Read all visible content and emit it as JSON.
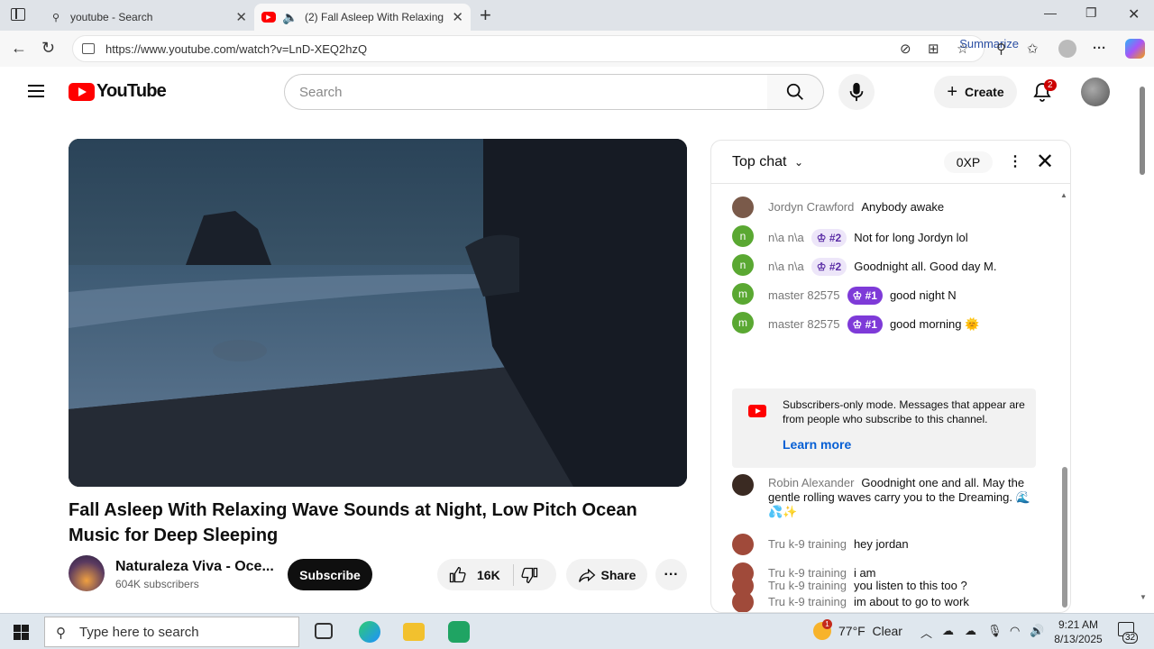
{
  "browser": {
    "tabs": [
      {
        "label": "youtube - Search"
      },
      {
        "label": "(2) Fall Asleep With Relaxing"
      }
    ],
    "url": "https://www.youtube.com/watch?v=LnD-XEQ2hzQ",
    "summarize_label": "Summarize"
  },
  "header": {
    "logo_text": "YouTube",
    "search_placeholder": "Search",
    "create_label": "Create",
    "notification_count": "2"
  },
  "video": {
    "title": "Fall Asleep With Relaxing Wave Sounds at Night, Low Pitch Ocean Music for Deep Sleeping",
    "channel_name": "Naturaleza Viva - Oce...",
    "subscribers": "604K subscribers",
    "subscribe_label": "Subscribe",
    "likes": "16K",
    "share_label": "Share"
  },
  "chat": {
    "mode_label": "Top chat",
    "xp": "0XP",
    "messages": [
      {
        "author": "Jordyn Crawford",
        "badge": "",
        "text": "Anybody awake",
        "avatar_letter": "",
        "avatar_color": "#7a5a4a"
      },
      {
        "author": "n\\a n\\a",
        "badge": "#2",
        "text": "Not for long Jordyn lol",
        "avatar_letter": "n",
        "avatar_color": "#5aa832"
      },
      {
        "author": "n\\a n\\a",
        "badge": "#2",
        "text": "Goodnight all. Good day M.",
        "avatar_letter": "n",
        "avatar_color": "#5aa832"
      },
      {
        "author": "master 82575",
        "badge": "#1",
        "text": "good night N",
        "avatar_letter": "m",
        "avatar_color": "#5aa832"
      },
      {
        "author": "master 82575",
        "badge": "#1",
        "text": "good morning 🌞",
        "avatar_letter": "m",
        "avatar_color": "#5aa832"
      },
      {
        "author": "Robin Alexander",
        "badge": "",
        "text": "Goodnight one and all. May the gentle rolling waves carry you to the Dreaming. 🌊💦✨",
        "avatar_letter": "",
        "avatar_color": "#3a2a22"
      },
      {
        "author": "Tru k-9 training",
        "badge": "",
        "text": "hey jordan",
        "avatar_letter": "",
        "avatar_color": "#a04a3a"
      },
      {
        "author": "Tru k-9 training",
        "badge": "",
        "text": "i am",
        "avatar_letter": "",
        "avatar_color": "#a04a3a"
      },
      {
        "author": "Tru k-9 training",
        "badge": "",
        "text": "im about to go to work",
        "avatar_letter": "",
        "avatar_color": "#a04a3a"
      },
      {
        "author": "Tru k-9 training",
        "badge": "",
        "text": "you listen to this too ?",
        "avatar_letter": "",
        "avatar_color": "#a04a3a"
      }
    ],
    "notice": {
      "text": "Subscribers-only mode. Messages that appear are from people who subscribe to this channel.",
      "link": "Learn more"
    }
  },
  "taskbar": {
    "search_placeholder": "Type here to search",
    "weather_temp": "77°F",
    "weather_desc": "Clear",
    "weather_badge": "1",
    "time": "9:21 AM",
    "date": "8/13/2025",
    "notification_count": "32"
  },
  "colors": {
    "youtube_red": "#ff0000",
    "crown_purple": "#7e3ad8",
    "link_blue": "#065fd4"
  }
}
